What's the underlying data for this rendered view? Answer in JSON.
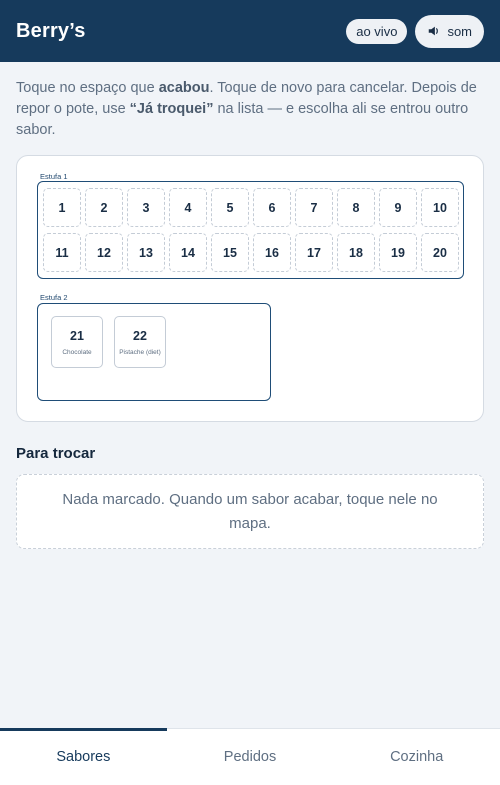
{
  "header": {
    "brand": "Berry’s",
    "live_label": "ao vivo",
    "sound_label": "som",
    "sound_icon": "speaker-icon"
  },
  "instructions": {
    "part1": "Toque no espaço que ",
    "bold1": "acabou",
    "part2": ". Toque de novo para cancelar. Depois de repor o pote, use ",
    "bold2": "“Já troquei”",
    "part3": " na lista — e escolha ali se entrou outro sabor."
  },
  "map": {
    "estufa1": {
      "label": "Estufa 1",
      "slots": [
        "1",
        "2",
        "3",
        "4",
        "5",
        "6",
        "7",
        "8",
        "9",
        "10",
        "11",
        "12",
        "13",
        "14",
        "15",
        "16",
        "17",
        "18",
        "19",
        "20"
      ]
    },
    "estufa2": {
      "label": "Estufa 2",
      "slots": [
        {
          "number": "21",
          "flavor": "Chocolate"
        },
        {
          "number": "22",
          "flavor": "Pistache (diet)"
        }
      ]
    }
  },
  "swap": {
    "title": "Para trocar",
    "empty_message": "Nada marcado. Quando um sabor acabar, toque nele no mapa."
  },
  "tabs": [
    {
      "label": "Sabores",
      "active": true
    },
    {
      "label": "Pedidos",
      "active": false
    },
    {
      "label": "Cozinha",
      "active": false
    }
  ],
  "colors": {
    "header_bg": "#163a5c",
    "page_bg": "#f1f4f8",
    "accent": "#1f4d77"
  }
}
